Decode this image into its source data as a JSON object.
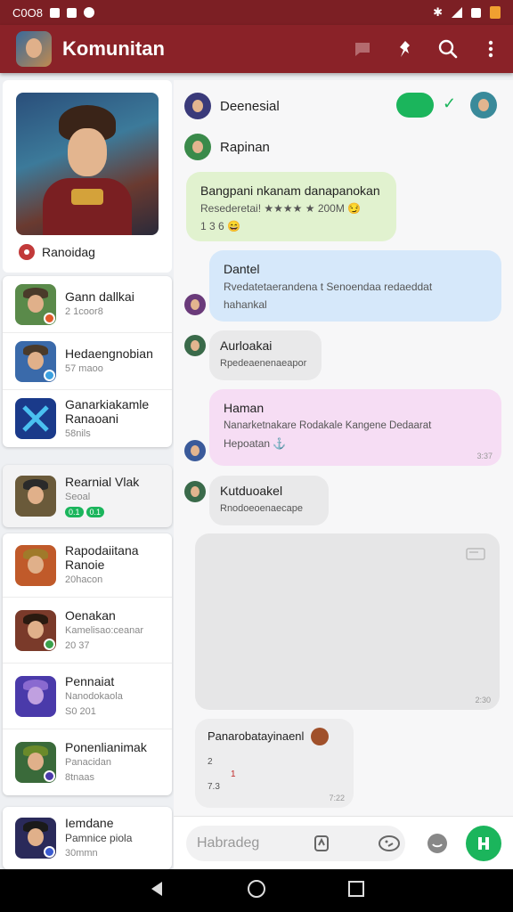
{
  "status_bar": {
    "time": "C0O8"
  },
  "app_bar": {
    "title": "Komunitan"
  },
  "sidebar": {
    "hero_label": "Ranoidag",
    "group1": [
      {
        "name": "Gann dallkai",
        "sub": "2 1coor8",
        "thumb": "#5a8a4a",
        "mini": "#e05a2a"
      },
      {
        "name": "Hedaengnobian",
        "sub": "57 maoo",
        "thumb": "#3a6aaa",
        "mini": "#3aa0e0"
      },
      {
        "name": "Ganarkiakamle Ranaoani",
        "sub": "58nils",
        "thumb": "#1a3a8a",
        "mini": "#f0a030"
      }
    ],
    "active": {
      "name": "Rearnial Vlak",
      "sub": "Seoal",
      "thumb": "#6a5a3a",
      "chips": [
        "0.1",
        "0.1"
      ]
    },
    "group2": [
      {
        "name": "Rapodaiitana Ranoie",
        "sub": "20hacon",
        "thumb": "#c05a2a",
        "mini": ""
      },
      {
        "name": "Oenakan",
        "sub": "Kamelisao:ceanar",
        "sub2": "20 37",
        "thumb": "#7a3a2a",
        "mini": "#3aa04a"
      },
      {
        "name": "Pennaiat",
        "sub": "Nanodokaola",
        "sub2": "S0 201",
        "thumb": "#4a3aaa",
        "mini": ""
      },
      {
        "name": "Ponenlianimak",
        "sub": "Panacidan",
        "sub2": "8tnaas",
        "thumb": "#3a6a3a",
        "mini": "#4a3aaa"
      }
    ],
    "last": {
      "name": "Iemdane",
      "sub": "Pamnice piola",
      "sub2": "30mmn",
      "thumb": "#2a2a5a",
      "mini": "#3a5ad0"
    }
  },
  "chat": {
    "header_name": "Deenesial",
    "second_name": "Rapinan",
    "messages": [
      {
        "title": "Bangpani nkanam danapanokan",
        "line": "Resederetai! ★★★★ ★ 200M 😏",
        "line2": "1 3 6 😄"
      },
      {
        "title": "Dantel",
        "line": "Rvedatetaerandena t Senoendaa redaeddat",
        "line2": "hahankal"
      },
      {
        "title": "Aurloakai",
        "line": "Rpedeaenenaeapor"
      },
      {
        "title": "Haman",
        "line": "Nanarketnakare Rodakale Kangene Dedaarat",
        "line2": "Hepoatan ⚓",
        "time": "3:37"
      },
      {
        "title": "Kutduoakel",
        "line": "Rnodoeoenaecape"
      },
      {
        "time": "2:30"
      },
      {
        "title": "Panarobatayinaenl",
        "line": "2",
        "line2": "1",
        "line3": "7.3",
        "time": "7:22"
      }
    ]
  },
  "composer": {
    "placeholder": "Habradeg"
  },
  "colors": {
    "primary": "#8a2228",
    "accent": "#1bb55c"
  }
}
